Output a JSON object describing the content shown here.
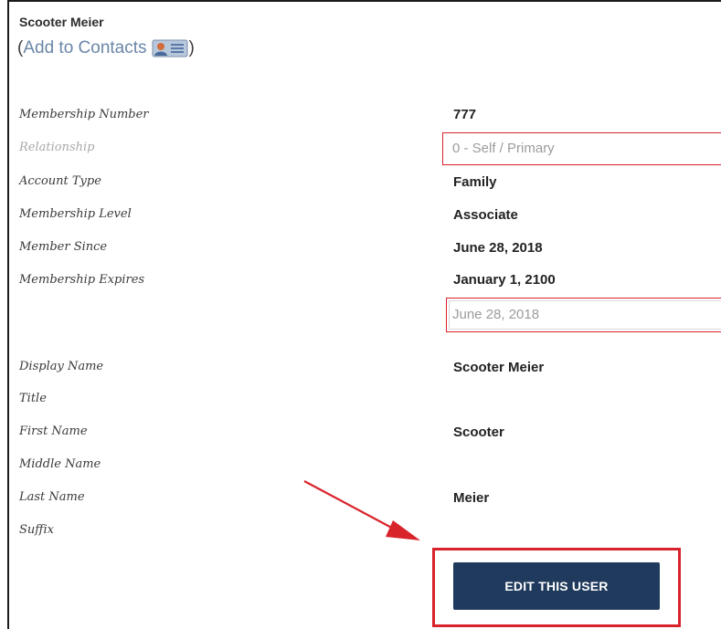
{
  "header": {
    "name": "Scooter Meier",
    "open_paren": "(",
    "add_contacts_label": "Add to Contacts",
    "close_paren": ")"
  },
  "fields": {
    "membership_number": {
      "label": "Membership Number",
      "value": "777"
    },
    "relationship": {
      "label": "Relationship",
      "value": "0 - Self / Primary"
    },
    "account_type": {
      "label": "Account Type",
      "value": "Family"
    },
    "membership_level": {
      "label": "Membership Level",
      "value": "Associate"
    },
    "member_since": {
      "label": "Member Since",
      "value": "June 28, 2018"
    },
    "membership_expires": {
      "label": "Membership Expires",
      "value": "January 1, 2100"
    },
    "expiry_input": {
      "value": "June 28, 2018"
    },
    "display_name": {
      "label": "Display Name",
      "value": "Scooter Meier"
    },
    "title": {
      "label": "Title",
      "value": ""
    },
    "first_name": {
      "label": "First Name",
      "value": "Scooter"
    },
    "middle_name": {
      "label": "Middle Name",
      "value": ""
    },
    "last_name": {
      "label": "Last Name",
      "value": "Meier"
    },
    "suffix": {
      "label": "Suffix",
      "value": ""
    }
  },
  "actions": {
    "edit_label": "EDIT THIS USER"
  },
  "colors": {
    "annotation_red": "#d9232b",
    "button_navy": "#1f3a5c",
    "link_blue": "#6a86a8"
  },
  "icons": {
    "add_contact": "contact-card-icon"
  }
}
